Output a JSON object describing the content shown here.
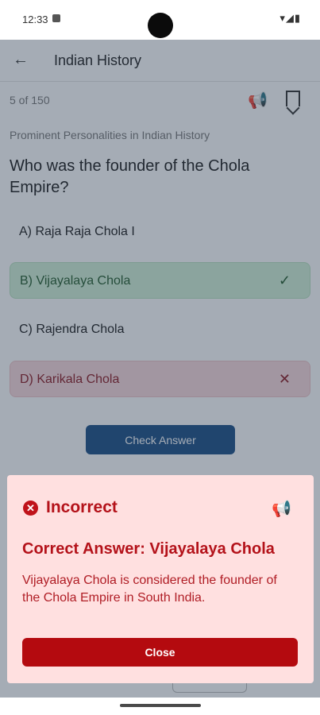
{
  "status_bar": {
    "time": "12:33",
    "notification_icon": "sim-card-icon",
    "icons": [
      "wifi-icon",
      "signal-icon",
      "battery-icon"
    ]
  },
  "app_bar": {
    "back_icon": "arrow-left-icon",
    "title": "Indian History"
  },
  "question_view": {
    "counter": "5 of 150",
    "category": "Prominent Personalities in Indian History",
    "question": "Who was the founder of the Chola Empire?",
    "options": [
      {
        "label": "A) Raja Raja Chola I",
        "state": "normal"
      },
      {
        "label": "B) Vijayalaya Chola",
        "state": "correct",
        "mark": "✓"
      },
      {
        "label": "C) Rajendra Chola",
        "state": "normal"
      },
      {
        "label": "D) Karikala Chola",
        "state": "incorrect",
        "mark": "✕"
      }
    ],
    "check_button": "Check Answer"
  },
  "result_sheet": {
    "status": "Incorrect",
    "correct_answer": "Correct Answer: Vijayalaya Chola",
    "explanation": "Vijayalaya Chola is considered the founder of the Chola Empire in South India.",
    "close_button": "Close"
  },
  "colors": {
    "primary": "#1b4e86",
    "error": "#b4121a",
    "correct_bg": "#d3f1d7",
    "incorrect_bg": "#fadadd",
    "sheet_bg": "#ffe0e0"
  }
}
